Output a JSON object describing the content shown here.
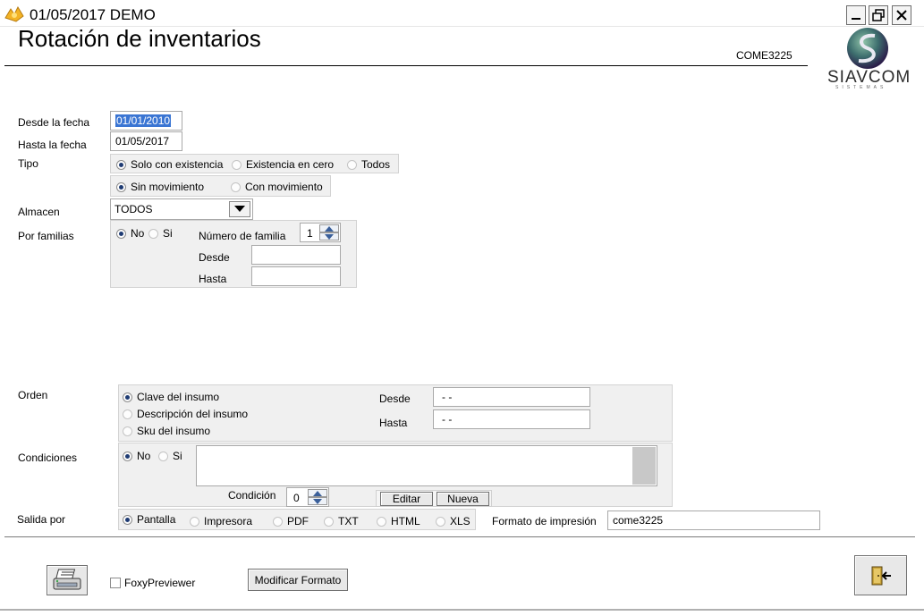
{
  "window": {
    "title": "01/05/2017  DEMO"
  },
  "header": {
    "heading": "Rotación de inventarios",
    "code": "COME3225",
    "logo_text": "SIAVCOM",
    "logo_subtext": "SISTEMAS"
  },
  "fields": {
    "desde_fecha": {
      "label": "Desde la fecha",
      "value": "01/01/2010"
    },
    "hasta_fecha": {
      "label": "Hasta la fecha",
      "value": "01/05/2017"
    },
    "tipo": {
      "label": "Tipo",
      "options": [
        "Solo con existencia",
        "Existencia en cero",
        "Todos"
      ],
      "selected": 0
    },
    "movimiento": {
      "options": [
        "Sin movimiento",
        "Con movimiento"
      ],
      "selected": 0
    },
    "almacen": {
      "label": "Almacen",
      "value": "TODOS"
    },
    "familias": {
      "label": "Por familias",
      "options": [
        "No",
        "Si"
      ],
      "selected": 0,
      "numero_label": "Número de familia",
      "numero_value": "1",
      "desde_label": "Desde",
      "hasta_label": "Hasta"
    },
    "orden": {
      "label": "Orden",
      "options": [
        "Clave del insumo",
        "Descripción del insumo",
        "Sku del insumo"
      ],
      "selected": 0,
      "desde_label": "Desde",
      "desde_value": "- -",
      "hasta_label": "Hasta",
      "hasta_value": "- -"
    },
    "condiciones": {
      "label": "Condiciones",
      "options": [
        "No",
        "Si"
      ],
      "selected": 0,
      "condicion_label": "Condición",
      "condicion_value": "0",
      "editar_label": "Editar",
      "nueva_label": "Nueva"
    },
    "salida": {
      "label": "Salida por",
      "options": [
        "Pantalla",
        "Impresora",
        "PDF",
        "TXT",
        "HTML",
        "XLS"
      ],
      "selected": 0,
      "formato_label": "Formato de impresión",
      "formato_value": "come3225"
    }
  },
  "footer": {
    "foxy_label": "FoxyPreviewer",
    "modificar_label": "Modificar Formato"
  },
  "icons": {
    "app": "app-icon",
    "print": "printer-icon",
    "exit": "exit-door-icon"
  },
  "colors": {
    "selection": "#3a75d3",
    "panel": "#f0f0f0",
    "logo_purple": "#5a2a7a"
  }
}
